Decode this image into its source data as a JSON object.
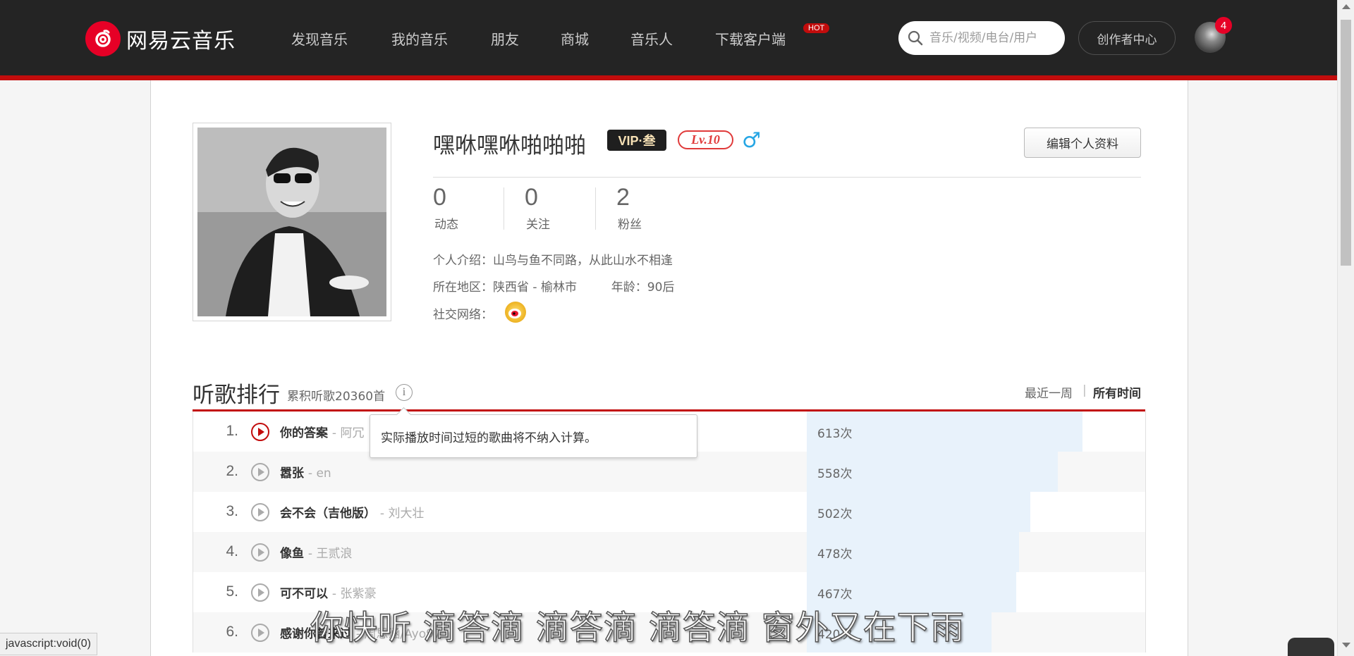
{
  "header": {
    "logo_text": "网易云音乐",
    "nav": [
      "发现音乐",
      "我的音乐",
      "朋友",
      "商城",
      "音乐人",
      "下载客户端"
    ],
    "hot_badge": "HOT",
    "search_placeholder": "音乐/视频/电台/用户",
    "creator_center": "创作者中心",
    "notification_count": "4",
    "accent_color": "#c20c0c"
  },
  "profile": {
    "username": "嘿咻嘿咻啪啪啪",
    "vip_badge": "VIP·叁",
    "level": "Lv.10",
    "gender_icon": "♂",
    "edit_button": "编辑个人资料",
    "stats": [
      {
        "value": "0",
        "label": "动态"
      },
      {
        "value": "0",
        "label": "关注"
      },
      {
        "value": "2",
        "label": "粉丝"
      }
    ],
    "bio_label": "个人介绍：",
    "bio": "山鸟与鱼不同路，从此山水不相逢",
    "region_label": "所在地区：",
    "region": "陕西省 - 榆林市",
    "age_label": "年龄：",
    "age": "90后",
    "social_label": "社交网络："
  },
  "ranking": {
    "title": "听歌排行",
    "total": "累积听歌20360首",
    "info_glyph": "i",
    "period_week": "最近一周",
    "period_sep": "|",
    "period_all": "所有时间",
    "tooltip": "实际播放时间过短的歌曲将不纳入计算。",
    "rows": [
      {
        "rank": "1.",
        "song": "你的答案",
        "artist": "- 阿冗",
        "count": "613次",
        "fraction": 1.0
      },
      {
        "rank": "2.",
        "song": "嚣张",
        "artist": "- en",
        "count": "558次",
        "fraction": 0.91
      },
      {
        "rank": "3.",
        "song": "会不会（吉他版）",
        "artist": "- 刘大壮",
        "count": "502次",
        "fraction": 0.81
      },
      {
        "rank": "4.",
        "song": "像鱼",
        "artist": "- 王贰浪",
        "count": "478次",
        "fraction": 0.77
      },
      {
        "rank": "5.",
        "song": "可不可以",
        "artist": "- 张紫豪",
        "count": "467次",
        "fraction": 0.76
      },
      {
        "rank": "6.",
        "song": "感谢你曾来过",
        "artist": "- 周思涵/Ayo97",
        "count": "420次",
        "fraction": 0.67
      }
    ]
  },
  "subtitle": "你快听 滴答滴 滴答滴 滴答滴 窗外又在下雨",
  "status_bar": "javascript:void(0)"
}
